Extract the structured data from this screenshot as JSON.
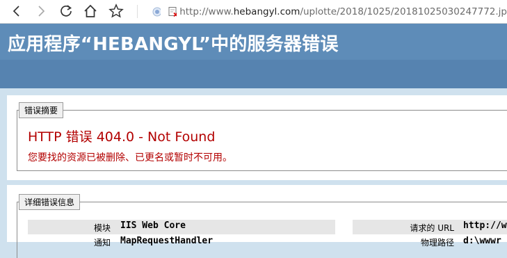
{
  "browser": {
    "url_prefix": "http://www.",
    "url_host": "hebangyl.com",
    "url_path": "/uplotte/2018/1025/20181025030247772.jp"
  },
  "page": {
    "header_title": "应用程序“HEBANGYL”中的服务器错误",
    "summary_legend": "错误摘要",
    "error_title": "HTTP 错误 404.0 - Not Found",
    "error_message": "您要找的资源已被删除、已更名或暂时不可用。",
    "detail_legend": "详细错误信息",
    "details_left": [
      {
        "label": "模块",
        "value": "IIS Web Core"
      },
      {
        "label": "通知",
        "value": "MapRequestHandler"
      }
    ],
    "details_right": [
      {
        "label": "请求的 URL",
        "value": "http://ww"
      },
      {
        "label": "物理路径",
        "value": "d:\\wwwr"
      }
    ]
  }
}
